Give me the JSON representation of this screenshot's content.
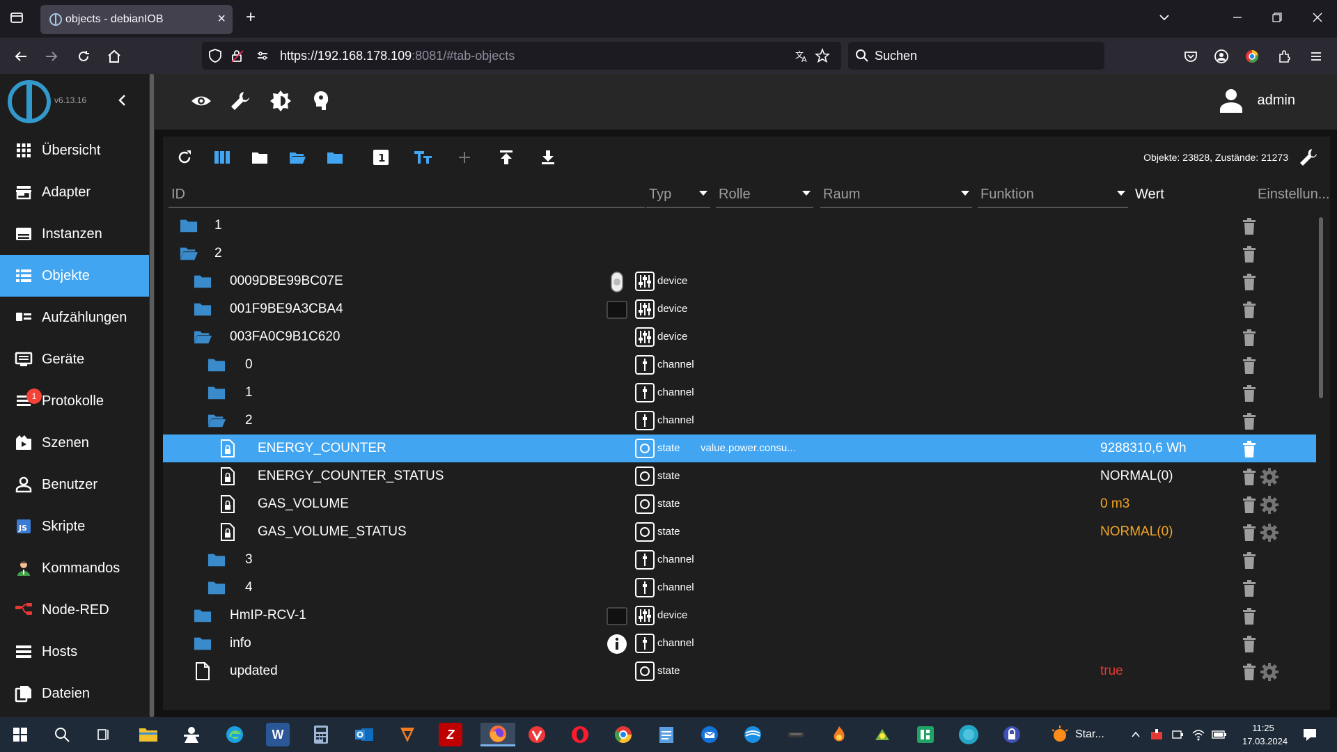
{
  "browser": {
    "tab_title": "objects - debianIOB",
    "url_host": "https://192.168.178.109",
    "url_rest": ":8081/#tab-objects",
    "search_placeholder": "Suchen"
  },
  "sidebar": {
    "version": "v6.13.16",
    "items": [
      {
        "label": "Übersicht",
        "icon": "apps-icon"
      },
      {
        "label": "Adapter",
        "icon": "store-icon"
      },
      {
        "label": "Instanzen",
        "icon": "instances-icon"
      },
      {
        "label": "Objekte",
        "icon": "list-icon",
        "active": true
      },
      {
        "label": "Aufzählungen",
        "icon": "enum-icon"
      },
      {
        "label": "Geräte",
        "icon": "devices-icon"
      },
      {
        "label": "Protokolle",
        "icon": "log-icon",
        "badge": "1"
      },
      {
        "label": "Szenen",
        "icon": "scenes-icon"
      },
      {
        "label": "Benutzer",
        "icon": "user-icon"
      },
      {
        "label": "Skripte",
        "icon": "js-icon"
      },
      {
        "label": "Kommandos",
        "icon": "kommandos-icon"
      },
      {
        "label": "Node-RED",
        "icon": "nodered-icon"
      },
      {
        "label": "Hosts",
        "icon": "hosts-icon"
      },
      {
        "label": "Dateien",
        "icon": "files-icon"
      }
    ]
  },
  "header": {
    "user": "admin"
  },
  "toolbar": {
    "counts": "Objekte: 23828, Zustände: 21273"
  },
  "columns": {
    "id": "ID",
    "type": "Typ",
    "role": "Rolle",
    "room": "Raum",
    "function": "Funktion",
    "value": "Wert",
    "settings": "Einstellun..."
  },
  "rows": [
    {
      "name": "1",
      "kind": "folder",
      "indent": 0
    },
    {
      "name": "2",
      "kind": "folder-open",
      "indent": 0
    },
    {
      "name": "0009DBE99BC07E",
      "kind": "folder",
      "indent": 1,
      "type": "device",
      "custom": "device-image"
    },
    {
      "name": "001F9BE9A3CBA4",
      "kind": "folder",
      "indent": 1,
      "type": "device",
      "custom": "device-image"
    },
    {
      "name": "003FA0C9B1C620",
      "kind": "folder-open",
      "indent": 1,
      "type": "device"
    },
    {
      "name": "0",
      "kind": "folder",
      "indent": 2,
      "type": "channel"
    },
    {
      "name": "1",
      "kind": "folder",
      "indent": 2,
      "type": "channel"
    },
    {
      "name": "2",
      "kind": "folder-open",
      "indent": 2,
      "type": "channel"
    },
    {
      "name": "ENERGY_COUNTER",
      "kind": "state-file",
      "indent": 3,
      "type": "state",
      "role": "value.power.consu...",
      "value": "9288310,6 Wh",
      "value_color": "#ffffff",
      "selected": true
    },
    {
      "name": "ENERGY_COUNTER_STATUS",
      "kind": "state-file",
      "indent": 3,
      "type": "state",
      "value": "NORMAL(0)",
      "value_color": "#ffffff",
      "gear": true
    },
    {
      "name": "GAS_VOLUME",
      "kind": "state-file",
      "indent": 3,
      "type": "state",
      "value": "0 m3",
      "value_color": "#f5a623",
      "gear": true
    },
    {
      "name": "GAS_VOLUME_STATUS",
      "kind": "state-file",
      "indent": 3,
      "type": "state",
      "value": "NORMAL(0)",
      "value_color": "#f5a623",
      "gear": true
    },
    {
      "name": "3",
      "kind": "folder",
      "indent": 2,
      "type": "channel"
    },
    {
      "name": "4",
      "kind": "folder",
      "indent": 2,
      "type": "channel"
    },
    {
      "name": "HmIP-RCV-1",
      "kind": "folder",
      "indent": 1,
      "type": "device",
      "custom": "device-image"
    },
    {
      "name": "info",
      "kind": "folder",
      "indent": 1,
      "type": "channel",
      "custom": "info"
    },
    {
      "name": "updated",
      "kind": "file",
      "indent": 1,
      "type": "state",
      "value": "true",
      "value_color": "#e53935",
      "gear": true
    }
  ],
  "taskbar": {
    "start_label": "Star...",
    "time": "11:25",
    "date": "17.03.2024"
  },
  "colors": {
    "accent": "#41a5f2",
    "sidebar_bg": "#1d1d1d",
    "panel_bg": "#1e1e1e"
  }
}
